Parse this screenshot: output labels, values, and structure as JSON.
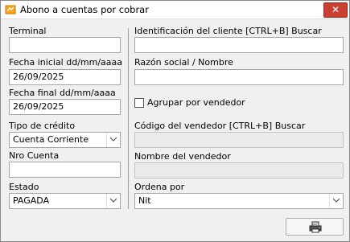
{
  "window": {
    "title": "Abono a cuentas por cobrar",
    "close_glyph": "✕"
  },
  "left": {
    "terminal_label": "Terminal",
    "terminal_value": "",
    "fecha_inicial_label": "Fecha inicial dd/mm/aaaa",
    "fecha_inicial_value": "26/09/2025",
    "fecha_final_label": "Fecha final dd/mm/aaaa",
    "fecha_final_value": "26/09/2025",
    "tipo_credito_label": "Tipo de crédito",
    "tipo_credito_value": "Cuenta Corriente",
    "nro_cuenta_label": "Nro Cuenta",
    "nro_cuenta_value": "",
    "estado_label": "Estado",
    "estado_value": "PAGADA"
  },
  "right": {
    "identificacion_label": "Identificación del cliente [CTRL+B] Buscar",
    "identificacion_value": "",
    "razon_social_label": "Razón social / Nombre",
    "razon_social_value": "",
    "agrupar_label": "Agrupar por vendedor",
    "agrupar_checked": false,
    "codigo_vendedor_label": "Código del vendedor [CTRL+B] Buscar",
    "codigo_vendedor_value": "",
    "nombre_vendedor_label": "Nombre del vendedor",
    "nombre_vendedor_value": "",
    "ordena_label": "Ordena por",
    "ordena_value": "Nit"
  },
  "icons": {
    "app": "app-icon",
    "close": "close-icon",
    "print": "printer-icon",
    "caret": "chevron-down-icon"
  },
  "colors": {
    "close_button": "#c84031",
    "window_bg": "#f0f0f0"
  }
}
